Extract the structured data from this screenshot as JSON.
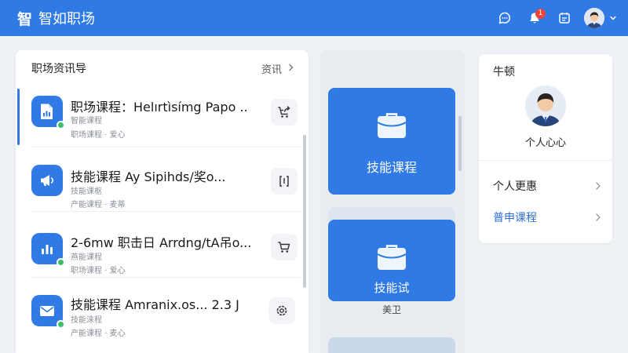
{
  "header": {
    "logo_text": "智",
    "app_name": "智如职场",
    "notification_count": "1",
    "icons": [
      "help-icon",
      "bell-icon",
      "calendar-icon",
      "avatar",
      "chevron-down-icon"
    ]
  },
  "left_panel": {
    "title": "职场资讯导",
    "more_label": "资讯",
    "items": [
      {
        "title": "职场课程：Helırtìsímg Papo ..",
        "subtitle": "智能课程",
        "meta": "职场课程 · 爱心",
        "icon": "document-chart-icon",
        "action_icon": "cart-share-icon",
        "online": true,
        "selected": true
      },
      {
        "title": "技能课程  Ay Sipihds/奖o...",
        "subtitle": "技能课枢",
        "meta": "产能课程 · 麦蒂",
        "icon": "megaphone-icon",
        "action_icon": "code-bracket-icon",
        "online": false,
        "selected": false
      },
      {
        "title": "2-6mw 职击日  Arrdng/tA吊o...",
        "subtitle": "燕能课程",
        "meta": "职场课程 · 爱心",
        "icon": "bar-chart-icon",
        "action_icon": "cart-icon",
        "online": true,
        "selected": false
      },
      {
        "title": "技能课程  Amranix.os... 2.3 J",
        "subtitle": "技能涞程",
        "meta": "产能课程 · 麦心",
        "icon": "mail-icon",
        "action_icon": "gear-icon",
        "online": true,
        "selected": false
      }
    ]
  },
  "mid_panel": {
    "cards": [
      {
        "label": "技能课程",
        "icon": "briefcase-icon"
      },
      {
        "label": "技能试",
        "caption": "美卫",
        "icon": "briefcase-icon"
      }
    ]
  },
  "right_panel": {
    "title": "牛顿",
    "profile_name": "个人心心",
    "menu": [
      {
        "label": "个人更惠",
        "active": false
      },
      {
        "label": "普申课程",
        "active": true
      }
    ]
  },
  "colors": {
    "primary": "#2f7ae5",
    "online": "#3bbf6b",
    "badge": "#f04438",
    "background": "#eef1f5"
  }
}
